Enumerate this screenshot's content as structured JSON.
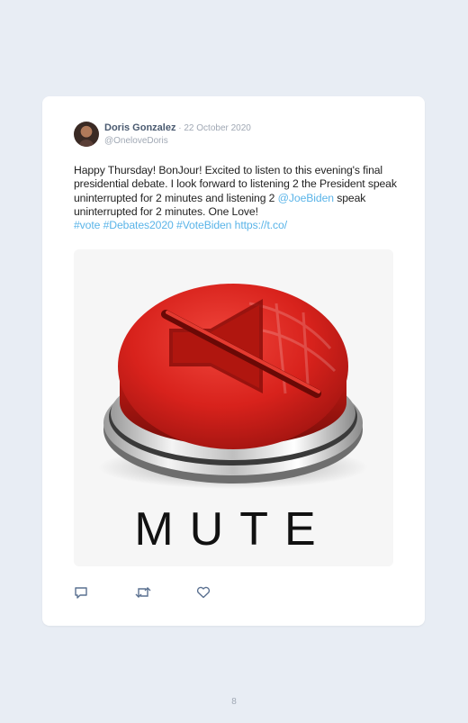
{
  "tweet": {
    "author_name": "Doris Gonzalez",
    "date_separator": " · ",
    "date": "22 October 2020",
    "handle": "@OneloveDoris",
    "text_part1": "Happy Thursday! BonJour! Excited to listen to this evening's final presidential debate. I look forward to listening 2 the President speak uninterrupted for 2 minutes and listening 2 ",
    "mention": "@JoeBiden",
    "text_part2": " speak uninterrupted for 2 minutes. One Love! ",
    "hashtags": [
      "#vote",
      "#Debates2020",
      "#VoteBiden"
    ],
    "short_link": "https://t.co/",
    "media": {
      "caption": "MUTE",
      "button_color": "#d8221c",
      "icon": "speaker-muted-icon"
    }
  },
  "actions": {
    "reply_icon": "reply-icon",
    "retweet_icon": "retweet-icon",
    "like_icon": "heart-icon"
  },
  "page_number": "8"
}
